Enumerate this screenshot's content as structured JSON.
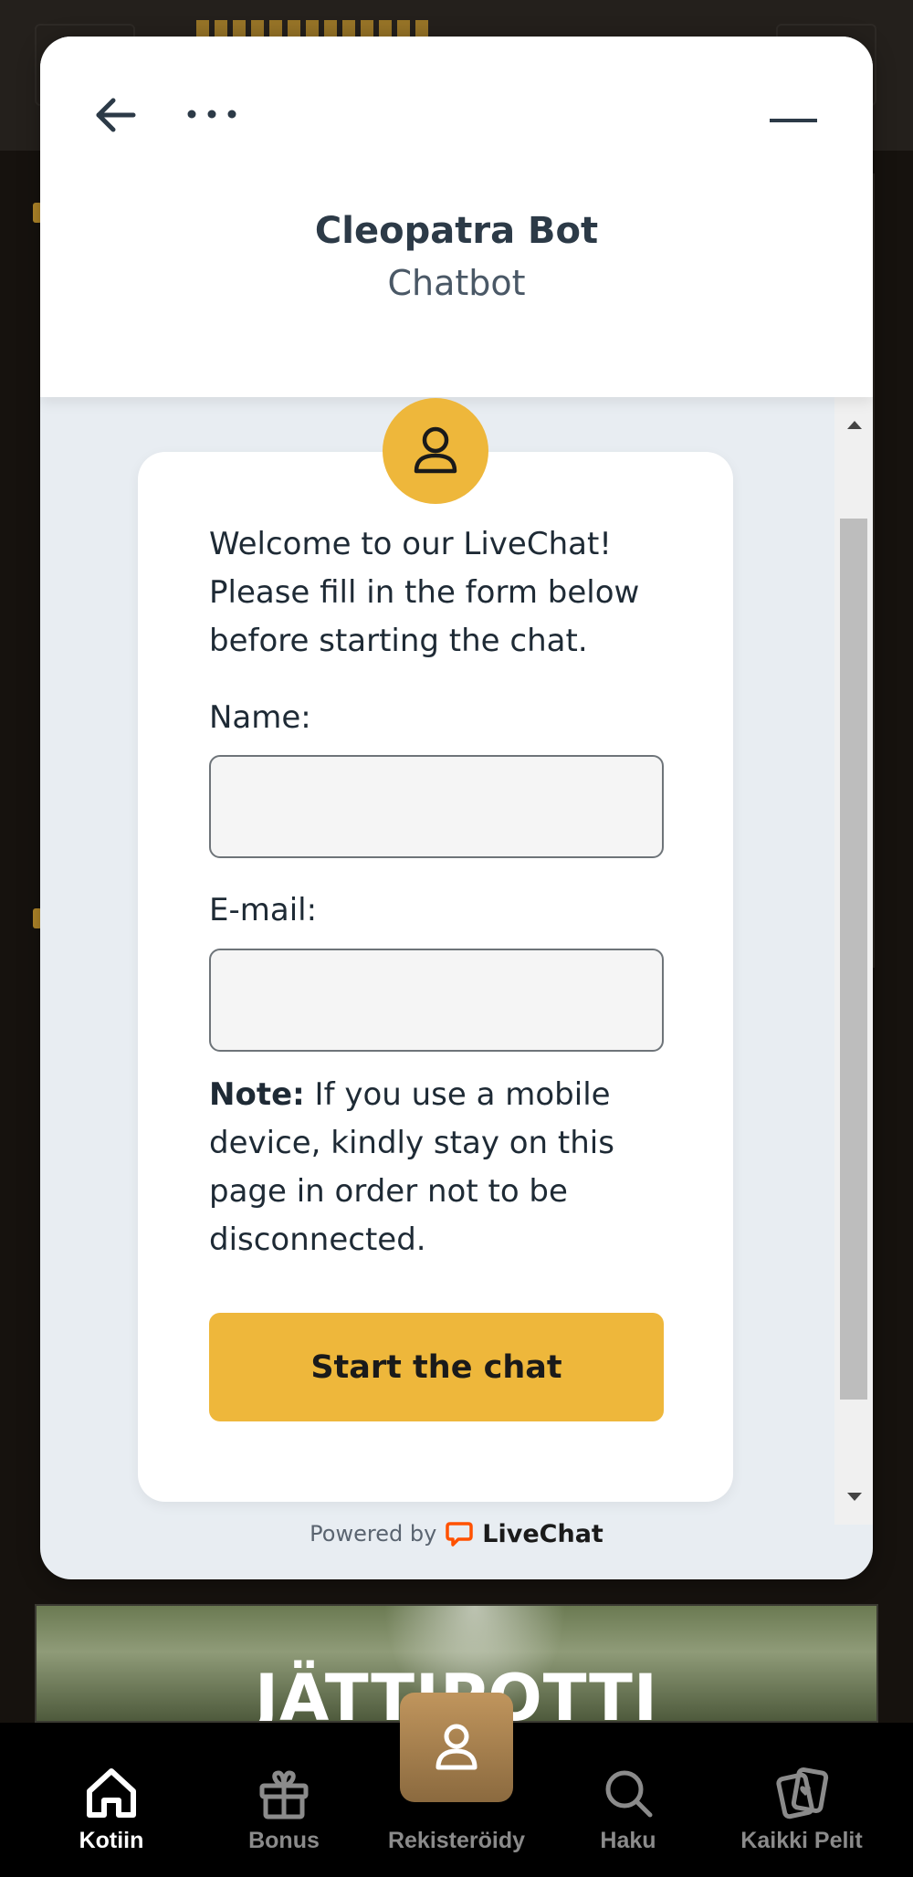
{
  "colors": {
    "accent": "#eeb73b",
    "header_bg": "#ffffff",
    "chat_bg": "#e8edf2",
    "nav_bg": "#000000",
    "livechat_brand": "#ff5100"
  },
  "chat": {
    "bot_name": "Cleopatra Bot",
    "bot_role": "Chatbot",
    "form": {
      "welcome": "Welcome to our LiveChat! Please fill in the form below before starting the chat.",
      "name_label": "Name:",
      "name_value": "",
      "email_label": "E-mail:",
      "email_value": "",
      "note_bold": "Note:",
      "note_text": " If you use a mobile device, kindly stay on this page in order not to be disconnected.",
      "submit_label": "Start the chat"
    },
    "footer": {
      "powered_by": "Powered by",
      "brand": "LiveChat"
    }
  },
  "site": {
    "banner_title": "JÄTTIPOTTI"
  },
  "bottom_nav": {
    "items": [
      {
        "label": "Kotiin",
        "icon": "home-icon",
        "active": true
      },
      {
        "label": "Bonus",
        "icon": "gift-icon",
        "active": false
      },
      {
        "label": "Rekisteröidy",
        "icon": "user-icon",
        "active": false
      },
      {
        "label": "Haku",
        "icon": "search-icon",
        "active": false
      },
      {
        "label": "Kaikki Pelit",
        "icon": "cards-icon",
        "active": false
      }
    ]
  }
}
